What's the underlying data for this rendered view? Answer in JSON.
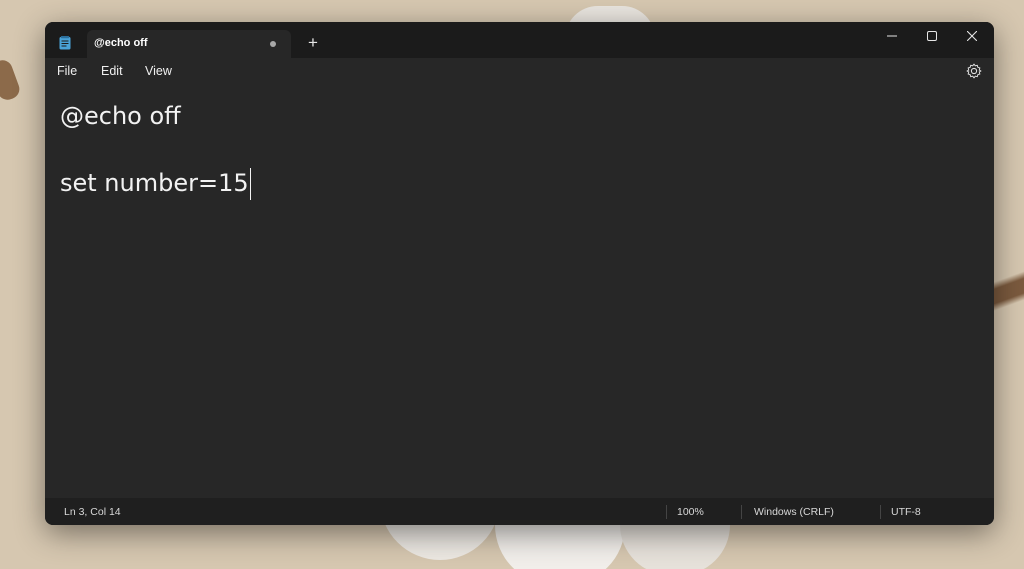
{
  "window": {
    "tab_title": "@echo off",
    "new_tab_label": "+",
    "icons": {
      "app": "notepad-icon",
      "minimize": "minimize-icon",
      "maximize": "maximize-icon",
      "close": "close-icon",
      "settings": "gear-icon",
      "unsaved": "unsaved-dot-icon"
    }
  },
  "menu": {
    "file": "File",
    "edit": "Edit",
    "view": "View"
  },
  "editor": {
    "line1": "@echo off",
    "line2": "",
    "line3": "set number=15"
  },
  "status": {
    "position": "Ln 3, Col 14",
    "zoom": "100%",
    "line_endings": "Windows (CRLF)",
    "encoding": "UTF-8"
  },
  "colors": {
    "window_bg": "#272727",
    "titlebar_bg": "#1b1b1b",
    "statusbar_bg": "#1f1f1f",
    "text": "#f2f2f2",
    "accent_icon": "#4aa3d8"
  }
}
